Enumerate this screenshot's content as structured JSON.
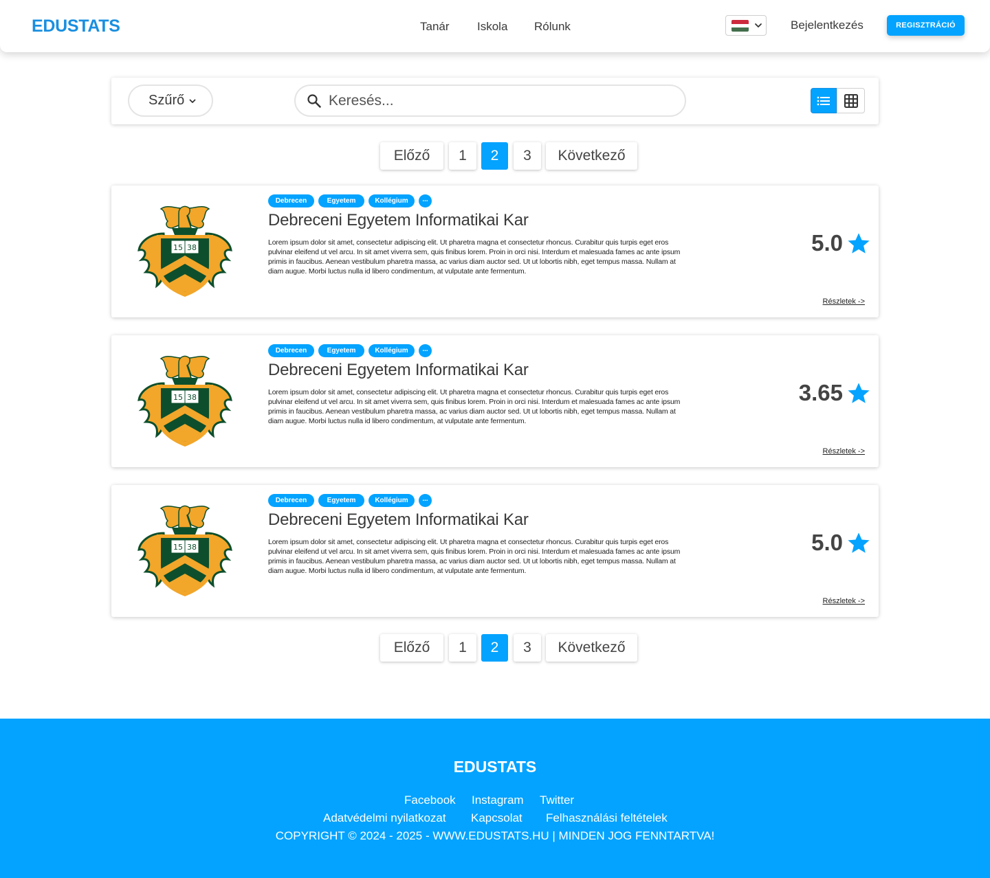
{
  "header": {
    "logo": "EDUSTATS",
    "nav": {
      "teacher": "Tanár",
      "school": "Iskola",
      "about": "Rólunk"
    },
    "language_flag": "hungary-flag",
    "login": "Bejelentkezés",
    "register": "REGISZTRÁCIÓ"
  },
  "toolbar": {
    "filter_label": "Szűrő",
    "search_placeholder": "Keresés...",
    "view_modes": [
      "list",
      "grid"
    ],
    "active_view": "list"
  },
  "pagination": {
    "prev": "Előző",
    "pages": [
      "1",
      "2",
      "3"
    ],
    "current_page": 2,
    "next": "Következő"
  },
  "cards": [
    {
      "tags": [
        "Debrecen",
        "Egyetem",
        "Kollégium",
        "..."
      ],
      "title": "Debreceni Egyetem Informatikai Kar",
      "description": "Lorem ipsum dolor sit amet, consectetur adipiscing elit. Ut pharetra magna et consectetur rhoncus. Curabitur quis turpis eget eros pulvinar eleifend ut vel arcu. In sit amet viverra sem, quis finibus lorem. Proin in orci nisi. Interdum et malesuada fames ac ante ipsum primis in faucibus. Aenean vestibulum pharetra massa, ac varius diam auctor sed. Ut ut lobortis nibh, eget tempus massa. Nullam at diam augue. Morbi luctus nulla id libero condimentum, at vulputate ante fermentum.",
      "rating": "5.0",
      "details": "Részletek ->"
    },
    {
      "tags": [
        "Debrecen",
        "Egyetem",
        "Kollégium",
        "..."
      ],
      "title": "Debreceni Egyetem Informatikai Kar",
      "description": "Lorem ipsum dolor sit amet, consectetur adipiscing elit. Ut pharetra magna et consectetur rhoncus. Curabitur quis turpis eget eros pulvinar eleifend ut vel arcu. In sit amet viverra sem, quis finibus lorem. Proin in orci nisi. Interdum et malesuada fames ac ante ipsum primis in faucibus. Aenean vestibulum pharetra massa, ac varius diam auctor sed. Ut ut lobortis nibh, eget tempus massa. Nullam at diam augue. Morbi luctus nulla id libero condimentum, at vulputate ante fermentum.",
      "rating": "3.65",
      "details": "Részletek ->"
    },
    {
      "tags": [
        "Debrecen",
        "Egyetem",
        "Kollégium",
        "..."
      ],
      "title": "Debreceni Egyetem Informatikai Kar",
      "description": "Lorem ipsum dolor sit amet, consectetur adipiscing elit. Ut pharetra magna et consectetur rhoncus. Curabitur quis turpis eget eros pulvinar eleifend ut vel arcu. In sit amet viverra sem, quis finibus lorem. Proin in orci nisi. Interdum et malesuada fames ac ante ipsum primis in faucibus. Aenean vestibulum pharetra massa, ac varius diam auctor sed. Ut ut lobortis nibh, eget tempus massa. Nullam at diam augue. Morbi luctus nulla id libero condimentum, at vulputate ante fermentum.",
      "rating": "5.0",
      "details": "Részletek ->"
    }
  ],
  "footer": {
    "logo": "EDUSTATS",
    "social": {
      "facebook": "Facebook",
      "instagram": "Instagram",
      "twitter": "Twitter"
    },
    "links": {
      "privacy": "Adatvédelmi nyilatkozat",
      "contact": "Kapcsolat",
      "terms": "Felhasználási feltételek"
    },
    "copyright": "COPYRIGHT © 2024 - 2025 - WWW.EDUSTATS.HU | MINDEN JOG FENNTARTVA!"
  },
  "colors": {
    "accent": "#03a3ff",
    "logo": "#1a8fe0",
    "crest_green": "#0d4f2c",
    "crest_gold": "#f2a62a"
  }
}
